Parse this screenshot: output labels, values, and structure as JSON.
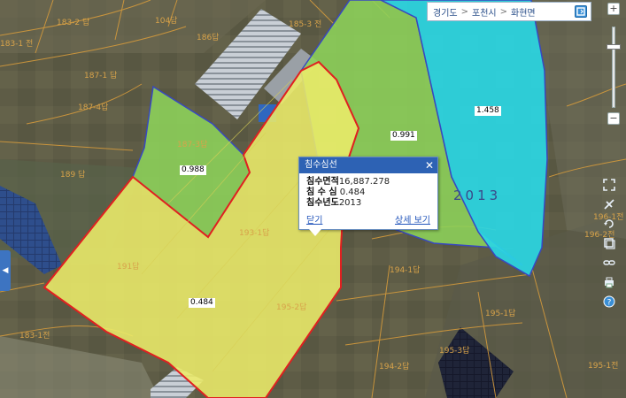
{
  "breadcrumb": {
    "province": "경기도",
    "city": "포천시",
    "town": "화현면",
    "separator": ">"
  },
  "parcel_labels": [
    "183-2 답",
    "104답",
    "186답",
    "185-3 전",
    "183-1 전",
    "187-1 답",
    "187-4답",
    "189 답",
    "191답",
    "193-1답",
    "194-1답",
    "195-1답",
    "195-2답",
    "195-3답",
    "194-2답",
    "183-1전",
    "196-2전",
    "196-1전",
    "195-1전",
    "187-3답"
  ],
  "values": {
    "v_0988": "0.988",
    "v_0991": "0.991",
    "v_1458": "1.458",
    "v_0484": "0.484"
  },
  "year_label": "2013",
  "popup": {
    "title": "침수심선",
    "close_glyph": "✕",
    "area_label": "침수면적",
    "area_value": "16,887.278",
    "depth_label": "침 수 심",
    "depth_value": "0.484",
    "year_label": "침수년도",
    "year_value": "2013",
    "close_link": "닫기",
    "detail_link": "상세 보기"
  },
  "colors": {
    "yellow_zone": "#ecec6a",
    "green_zone": "#8dd35a",
    "cyan_zone": "#2ad6e3",
    "selected_outline": "#e02020",
    "zone_outline": "#3848c0",
    "header_blue": "#2d62b4"
  },
  "icons": {
    "left_tab": "chevron-left-icon",
    "zoom_in": "plus-icon",
    "zoom_out": "minus-icon",
    "tools": [
      "fullscreen-icon",
      "measure-icon",
      "rotate-icon",
      "layers-icon",
      "link-icon",
      "print-icon",
      "help-icon"
    ]
  }
}
